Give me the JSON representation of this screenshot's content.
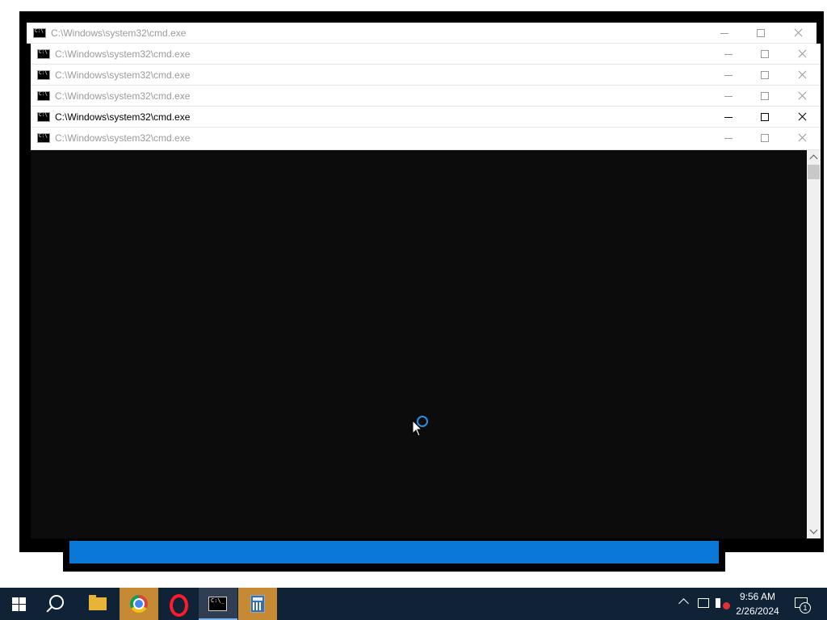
{
  "windows": [
    {
      "title": "C:\\Windows\\system32\\cmd.exe",
      "active": false
    },
    {
      "title": "C:\\Windows\\system32\\cmd.exe",
      "active": false
    },
    {
      "title": "C:\\Windows\\system32\\cmd.exe",
      "active": false
    },
    {
      "title": "C:\\Windows\\system32\\cmd.exe",
      "active": false
    },
    {
      "title": "C:\\Windows\\system32\\cmd.exe",
      "active": true
    },
    {
      "title": "C:\\Windows\\system32\\cmd.exe",
      "active": false
    }
  ],
  "taskbar": {
    "pinned": [
      "start-icon",
      "search-icon",
      "file-explorer-icon",
      "chrome-icon",
      "opera-icon",
      "cmd-icon",
      "calculator-icon"
    ],
    "clock_time": "9:56 AM",
    "clock_date": "2/26/2024",
    "notification_count": "1"
  },
  "colors": {
    "console_bg": "#0c0c0c",
    "taskbar_bg": "#0f2236",
    "accent": "#0a78d7"
  }
}
